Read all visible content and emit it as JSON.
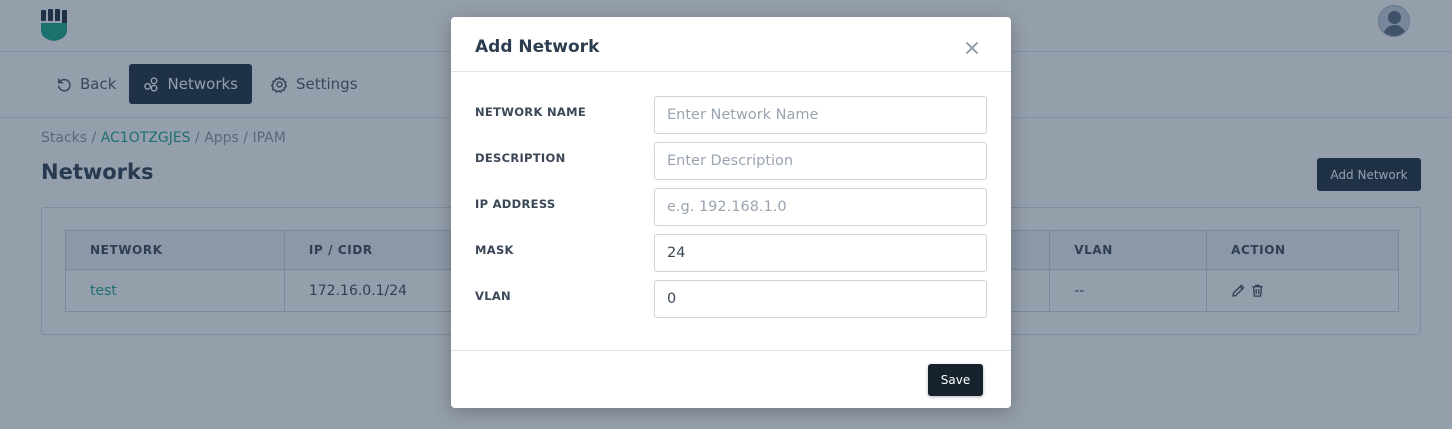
{
  "colors": {
    "accent": "#17a589",
    "dark_button": "#1b2d3d",
    "overlay": "rgba(33,54,82,0.48)"
  },
  "topbar": {
    "logo_icon": "fist-logo-icon",
    "avatar_icon": "user-avatar-icon"
  },
  "nav": {
    "back_label": "Back",
    "networks_label": "Networks",
    "settings_label": "Settings"
  },
  "breadcrumb": {
    "stacks": "Stacks",
    "sep1": " / ",
    "stack_id": "AC1OTZGJES",
    "sep2": " / ",
    "apps": "Apps",
    "sep3": " / ",
    "current": "IPAM"
  },
  "page": {
    "title": "Networks",
    "add_button": "Add Network"
  },
  "table": {
    "headers": {
      "network": "NETWORK",
      "ip_cidr": "IP / CIDR",
      "vlan": "VLAN",
      "action": "ACTION"
    },
    "rows": [
      {
        "network": "test",
        "ip_cidr": "172.16.0.1/24",
        "vlan": "--"
      }
    ]
  },
  "modal": {
    "title": "Add Network",
    "fields": {
      "network_name": {
        "label": "NETWORK NAME",
        "placeholder": "Enter Network Name",
        "value": ""
      },
      "description": {
        "label": "DESCRIPTION",
        "placeholder": "Enter Description",
        "value": ""
      },
      "ip_address": {
        "label": "IP ADDRESS",
        "placeholder": "e.g. 192.168.1.0",
        "value": ""
      },
      "mask": {
        "label": "MASK",
        "placeholder": "",
        "value": "24"
      },
      "vlan": {
        "label": "VLAN",
        "placeholder": "",
        "value": "0"
      }
    },
    "save_label": "Save"
  }
}
